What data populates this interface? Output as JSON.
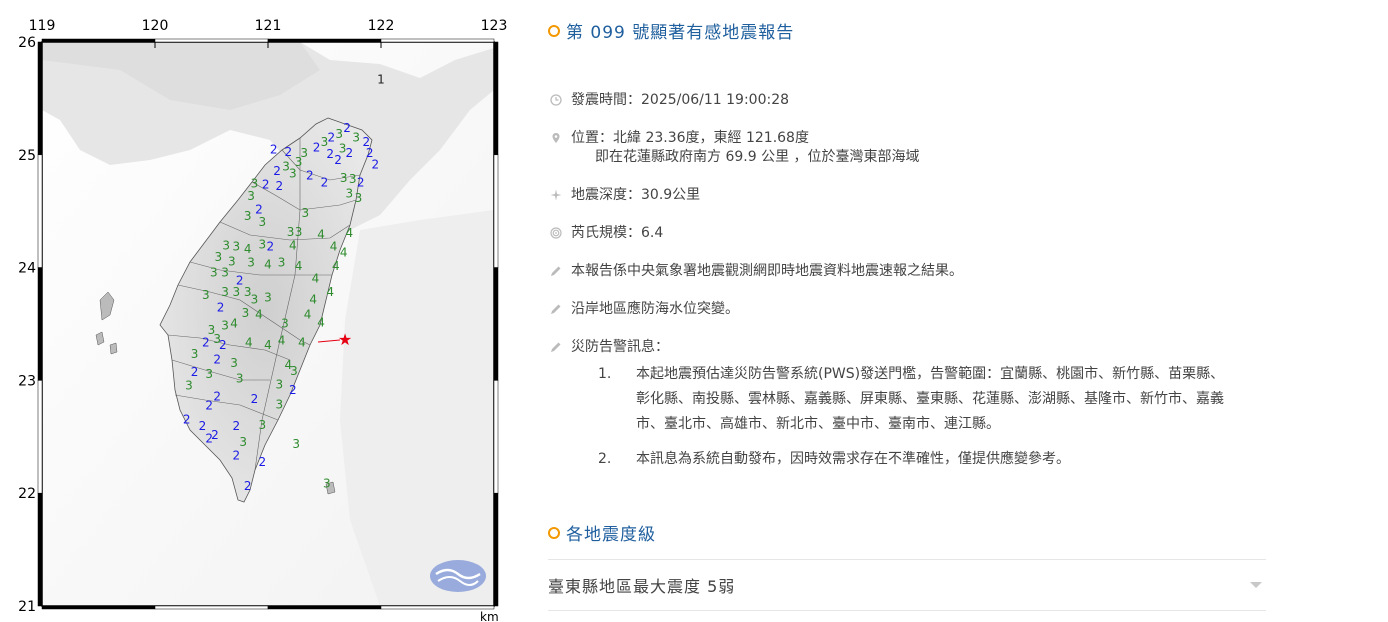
{
  "map": {
    "lon_ticks": [
      "119",
      "120",
      "121",
      "122",
      "123"
    ],
    "lat_ticks": [
      "26",
      "25",
      "24",
      "23",
      "22",
      "21"
    ],
    "scale_unit": "km",
    "epicenter_color": "#e60012",
    "intensity_colors": {
      "1": "#222222",
      "2": "#1a1ae6",
      "3": "#2e8b2e",
      "4": "#2e8b2e"
    },
    "intensity_labels": [
      {
        "v": "1",
        "lon": 122.0,
        "lat": 25.63
      },
      {
        "v": "2",
        "lon": 121.05,
        "lat": 25.01
      },
      {
        "v": "2",
        "lon": 121.18,
        "lat": 24.99
      },
      {
        "v": "3",
        "lon": 121.32,
        "lat": 24.98
      },
      {
        "v": "2",
        "lon": 121.43,
        "lat": 25.03
      },
      {
        "v": "3",
        "lon": 121.5,
        "lat": 25.08
      },
      {
        "v": "2",
        "lon": 121.56,
        "lat": 25.12
      },
      {
        "v": "3",
        "lon": 121.63,
        "lat": 25.15
      },
      {
        "v": "2",
        "lon": 121.7,
        "lat": 25.2
      },
      {
        "v": "3",
        "lon": 121.78,
        "lat": 25.12
      },
      {
        "v": "2",
        "lon": 121.87,
        "lat": 25.08
      },
      {
        "v": "2",
        "lon": 121.9,
        "lat": 24.98
      },
      {
        "v": "2",
        "lon": 121.95,
        "lat": 24.88
      },
      {
        "v": "2",
        "lon": 121.72,
        "lat": 24.98
      },
      {
        "v": "3",
        "lon": 121.66,
        "lat": 25.02
      },
      {
        "v": "2",
        "lon": 121.55,
        "lat": 24.97
      },
      {
        "v": "2",
        "lon": 121.62,
        "lat": 24.92
      },
      {
        "v": "3",
        "lon": 121.27,
        "lat": 24.9
      },
      {
        "v": "3",
        "lon": 121.16,
        "lat": 24.86
      },
      {
        "v": "2",
        "lon": 121.08,
        "lat": 24.82
      },
      {
        "v": "3",
        "lon": 121.22,
        "lat": 24.8
      },
      {
        "v": "2",
        "lon": 121.37,
        "lat": 24.78
      },
      {
        "v": "3",
        "lon": 121.67,
        "lat": 24.76
      },
      {
        "v": "3",
        "lon": 121.75,
        "lat": 24.75
      },
      {
        "v": "2",
        "lon": 121.82,
        "lat": 24.72
      },
      {
        "v": "3",
        "lon": 121.8,
        "lat": 24.58
      },
      {
        "v": "3",
        "lon": 121.72,
        "lat": 24.62
      },
      {
        "v": "2",
        "lon": 121.5,
        "lat": 24.72
      },
      {
        "v": "3",
        "lon": 120.88,
        "lat": 24.71
      },
      {
        "v": "2",
        "lon": 120.98,
        "lat": 24.7
      },
      {
        "v": "2",
        "lon": 121.1,
        "lat": 24.69
      },
      {
        "v": "3",
        "lon": 120.85,
        "lat": 24.6
      },
      {
        "v": "2",
        "lon": 120.92,
        "lat": 24.48
      },
      {
        "v": "3",
        "lon": 121.33,
        "lat": 24.45
      },
      {
        "v": "3",
        "lon": 120.82,
        "lat": 24.42
      },
      {
        "v": "3",
        "lon": 120.95,
        "lat": 24.37
      },
      {
        "v": "3",
        "lon": 121.2,
        "lat": 24.28
      },
      {
        "v": "3",
        "lon": 121.27,
        "lat": 24.28
      },
      {
        "v": "4",
        "lon": 121.47,
        "lat": 24.26
      },
      {
        "v": "4",
        "lon": 121.72,
        "lat": 24.27
      },
      {
        "v": "3",
        "lon": 120.63,
        "lat": 24.16
      },
      {
        "v": "3",
        "lon": 120.72,
        "lat": 24.15
      },
      {
        "v": "4",
        "lon": 120.82,
        "lat": 24.13
      },
      {
        "v": "3",
        "lon": 120.95,
        "lat": 24.17
      },
      {
        "v": "2",
        "lon": 121.02,
        "lat": 24.15
      },
      {
        "v": "4",
        "lon": 121.22,
        "lat": 24.16
      },
      {
        "v": "4",
        "lon": 121.58,
        "lat": 24.15
      },
      {
        "v": "4",
        "lon": 121.67,
        "lat": 24.1
      },
      {
        "v": "3",
        "lon": 120.56,
        "lat": 24.06
      },
      {
        "v": "3",
        "lon": 120.68,
        "lat": 24.02
      },
      {
        "v": "3",
        "lon": 120.85,
        "lat": 24.01
      },
      {
        "v": "4",
        "lon": 121.0,
        "lat": 23.99
      },
      {
        "v": "3",
        "lon": 121.12,
        "lat": 24.01
      },
      {
        "v": "4",
        "lon": 121.27,
        "lat": 23.98
      },
      {
        "v": "4",
        "lon": 121.6,
        "lat": 23.98
      },
      {
        "v": "3",
        "lon": 120.52,
        "lat": 23.92
      },
      {
        "v": "3",
        "lon": 120.62,
        "lat": 23.92
      },
      {
        "v": "2",
        "lon": 120.75,
        "lat": 23.85
      },
      {
        "v": "3",
        "lon": 120.62,
        "lat": 23.75
      },
      {
        "v": "3",
        "lon": 120.72,
        "lat": 23.75
      },
      {
        "v": "3",
        "lon": 120.82,
        "lat": 23.75
      },
      {
        "v": "4",
        "lon": 121.42,
        "lat": 23.87
      },
      {
        "v": "4",
        "lon": 121.55,
        "lat": 23.75
      },
      {
        "v": "3",
        "lon": 120.88,
        "lat": 23.68
      },
      {
        "v": "3",
        "lon": 121.0,
        "lat": 23.7
      },
      {
        "v": "4",
        "lon": 121.4,
        "lat": 23.68
      },
      {
        "v": "3",
        "lon": 120.45,
        "lat": 23.72
      },
      {
        "v": "2",
        "lon": 120.58,
        "lat": 23.61
      },
      {
        "v": "3",
        "lon": 120.8,
        "lat": 23.56
      },
      {
        "v": "4",
        "lon": 120.92,
        "lat": 23.55
      },
      {
        "v": "4",
        "lon": 121.35,
        "lat": 23.55
      },
      {
        "v": "4",
        "lon": 121.47,
        "lat": 23.48
      },
      {
        "v": "3",
        "lon": 121.15,
        "lat": 23.47
      },
      {
        "v": "3",
        "lon": 120.5,
        "lat": 23.41
      },
      {
        "v": "3",
        "lon": 120.62,
        "lat": 23.45
      },
      {
        "v": "4",
        "lon": 120.7,
        "lat": 23.47
      },
      {
        "v": "2",
        "lon": 120.45,
        "lat": 23.3
      },
      {
        "v": "3",
        "lon": 120.55,
        "lat": 23.33
      },
      {
        "v": "2",
        "lon": 120.6,
        "lat": 23.28
      },
      {
        "v": "4",
        "lon": 120.83,
        "lat": 23.3
      },
      {
        "v": "4",
        "lon": 121.0,
        "lat": 23.28
      },
      {
        "v": "4",
        "lon": 121.12,
        "lat": 23.32
      },
      {
        "v": "4",
        "lon": 121.3,
        "lat": 23.3
      },
      {
        "v": "3",
        "lon": 120.35,
        "lat": 23.2
      },
      {
        "v": "2",
        "lon": 120.55,
        "lat": 23.15
      },
      {
        "v": "3",
        "lon": 120.7,
        "lat": 23.12
      },
      {
        "v": "4",
        "lon": 121.18,
        "lat": 23.1
      },
      {
        "v": "3",
        "lon": 121.23,
        "lat": 23.05
      },
      {
        "v": "2",
        "lon": 120.35,
        "lat": 23.04
      },
      {
        "v": "3",
        "lon": 120.48,
        "lat": 23.02
      },
      {
        "v": "3",
        "lon": 120.75,
        "lat": 22.98
      },
      {
        "v": "3",
        "lon": 121.1,
        "lat": 22.93
      },
      {
        "v": "2",
        "lon": 121.22,
        "lat": 22.88
      },
      {
        "v": "3",
        "lon": 120.3,
        "lat": 22.92
      },
      {
        "v": "2",
        "lon": 120.55,
        "lat": 22.82
      },
      {
        "v": "2",
        "lon": 120.88,
        "lat": 22.8
      },
      {
        "v": "3",
        "lon": 121.1,
        "lat": 22.75
      },
      {
        "v": "2",
        "lon": 120.48,
        "lat": 22.74
      },
      {
        "v": "2",
        "lon": 120.28,
        "lat": 22.62
      },
      {
        "v": "2",
        "lon": 120.42,
        "lat": 22.56
      },
      {
        "v": "2",
        "lon": 120.72,
        "lat": 22.56
      },
      {
        "v": "3",
        "lon": 120.95,
        "lat": 22.57
      },
      {
        "v": "2",
        "lon": 120.53,
        "lat": 22.48
      },
      {
        "v": "3",
        "lon": 120.78,
        "lat": 22.42
      },
      {
        "v": "3",
        "lon": 121.25,
        "lat": 22.4
      },
      {
        "v": "2",
        "lon": 120.72,
        "lat": 22.3
      },
      {
        "v": "2",
        "lon": 120.82,
        "lat": 22.03
      },
      {
        "v": "3",
        "lon": 121.52,
        "lat": 22.05
      },
      {
        "v": "2",
        "lon": 120.48,
        "lat": 22.45
      },
      {
        "v": "2",
        "lon": 120.95,
        "lat": 22.24
      }
    ]
  },
  "report": {
    "title": "第 099 號顯著有感地震報告",
    "time_label": "發震時間：",
    "time_value": "2025/06/11 19:00:28",
    "location_label": "位置：",
    "location_value": "北緯 23.36度，東經 121.68度",
    "location_desc": "即在花蓮縣政府南方 69.9 公里 ，位於臺灣東部海域",
    "depth_label": "地震深度：",
    "depth_value": "30.9公里",
    "magnitude_label": "芮氏規模：",
    "magnitude_value": "6.4",
    "note1": "本報告係中央氣象署地震觀測網即時地震資料地震速報之結果。",
    "note2": "沿岸地區應防海水位突變。",
    "warning_label": "災防告警訊息：",
    "warnings": [
      {
        "num": "1.",
        "text": "本起地震預估達災防告警系統(PWS)發送門檻，告警範圍：宜蘭縣、桃園市、新竹縣、苗栗縣、彰化縣、南投縣、雲林縣、嘉義縣、屏東縣、臺東縣、花蓮縣、澎湖縣、基隆市、新竹市、嘉義市、臺北市、高雄市、新北市、臺中市、臺南市、連江縣。"
      },
      {
        "num": "2.",
        "text": "本訊息為系統自動發布，因時效需求存在不準確性，僅提供應變參考。"
      }
    ]
  },
  "intensity": {
    "title": "各地震度級",
    "max_text": "臺東縣地區最大震度 5弱"
  },
  "colors": {
    "accent": "#f39800",
    "title": "#1f5f9e"
  }
}
